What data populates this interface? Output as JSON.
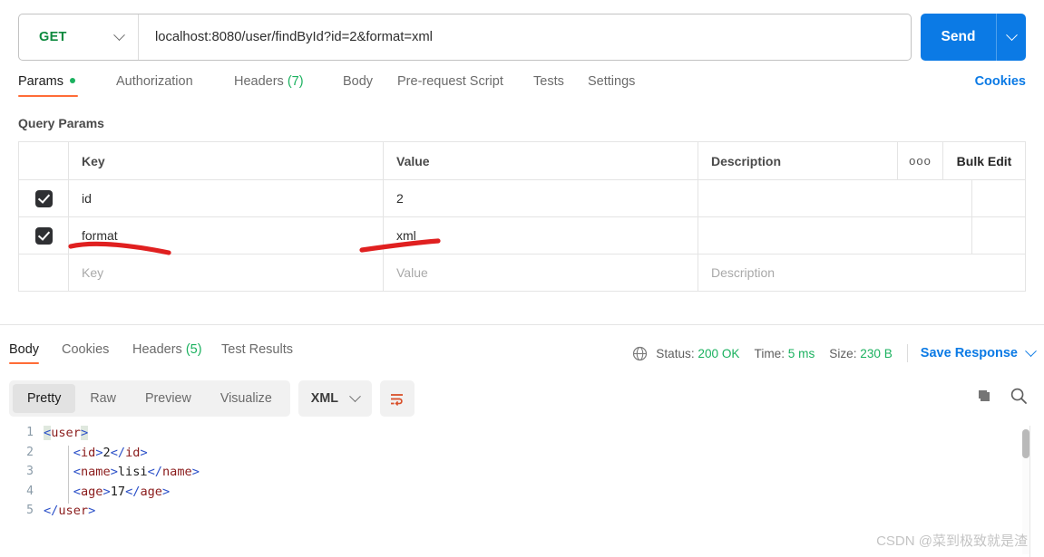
{
  "request": {
    "method": "GET",
    "url": "localhost:8080/user/findById?id=2&format=xml",
    "send_label": "Send",
    "tabs": [
      {
        "label": "Params",
        "active": true,
        "dot": true
      },
      {
        "label": "Authorization",
        "active": false
      },
      {
        "label": "Headers",
        "count": "(7)",
        "active": false
      },
      {
        "label": "Body",
        "active": false
      },
      {
        "label": "Pre-request Script",
        "active": false
      },
      {
        "label": "Tests",
        "active": false
      },
      {
        "label": "Settings",
        "active": false
      }
    ],
    "cookies_label": "Cookies"
  },
  "query_params": {
    "title": "Query Params",
    "columns": {
      "key": "Key",
      "value": "Value",
      "description": "Description"
    },
    "dots_label": "ooo",
    "bulk_edit_label": "Bulk Edit",
    "rows": [
      {
        "checked": true,
        "key": "id",
        "value": "2",
        "description": ""
      },
      {
        "checked": true,
        "key": "format",
        "value": "xml",
        "description": ""
      }
    ],
    "placeholder_row": {
      "key": "Key",
      "value": "Value",
      "description": "Description"
    },
    "annotation_color": "#e02020"
  },
  "response": {
    "tabs": [
      {
        "label": "Body",
        "active": true
      },
      {
        "label": "Cookies",
        "active": false
      },
      {
        "label": "Headers",
        "count": "(5)",
        "active": false
      },
      {
        "label": "Test Results",
        "active": false
      }
    ],
    "status_label": "Status:",
    "status_value": "200 OK",
    "time_label": "Time:",
    "time_value": "5 ms",
    "size_label": "Size:",
    "size_value": "230 B",
    "save_response_label": "Save Response",
    "view_modes": [
      {
        "label": "Pretty",
        "active": true
      },
      {
        "label": "Raw",
        "active": false
      },
      {
        "label": "Preview",
        "active": false
      },
      {
        "label": "Visualize",
        "active": false
      }
    ],
    "format": "XML",
    "code_lines": [
      {
        "n": "1",
        "segments": [
          {
            "t": "<",
            "c": "tg hl"
          },
          {
            "t": "user",
            "c": "tn"
          },
          {
            "t": ">",
            "c": "tg hl"
          }
        ]
      },
      {
        "n": "2",
        "segments": [
          {
            "t": "    ",
            "c": ""
          },
          {
            "t": "<",
            "c": "tg"
          },
          {
            "t": "id",
            "c": "tn"
          },
          {
            "t": ">",
            "c": "tg"
          },
          {
            "t": "2",
            "c": ""
          },
          {
            "t": "</",
            "c": "tg"
          },
          {
            "t": "id",
            "c": "tn"
          },
          {
            "t": ">",
            "c": "tg"
          }
        ]
      },
      {
        "n": "3",
        "segments": [
          {
            "t": "    ",
            "c": ""
          },
          {
            "t": "<",
            "c": "tg"
          },
          {
            "t": "name",
            "c": "tn"
          },
          {
            "t": ">",
            "c": "tg"
          },
          {
            "t": "lisi",
            "c": ""
          },
          {
            "t": "</",
            "c": "tg"
          },
          {
            "t": "name",
            "c": "tn"
          },
          {
            "t": ">",
            "c": "tg"
          }
        ]
      },
      {
        "n": "4",
        "segments": [
          {
            "t": "    ",
            "c": ""
          },
          {
            "t": "<",
            "c": "tg"
          },
          {
            "t": "age",
            "c": "tn"
          },
          {
            "t": ">",
            "c": "tg"
          },
          {
            "t": "17",
            "c": ""
          },
          {
            "t": "</",
            "c": "tg"
          },
          {
            "t": "age",
            "c": "tn"
          },
          {
            "t": ">",
            "c": "tg"
          }
        ]
      },
      {
        "n": "5",
        "segments": [
          {
            "t": "</",
            "c": "tg"
          },
          {
            "t": "user",
            "c": "tn"
          },
          {
            "t": ">",
            "c": "tg"
          }
        ]
      }
    ]
  },
  "watermark": "CSDN @菜到极致就是渣",
  "colors": {
    "accent_orange": "#ff6c37",
    "blue": "#0b7ae5",
    "green": "#1bb15f",
    "method_green": "#0d8a3e"
  }
}
